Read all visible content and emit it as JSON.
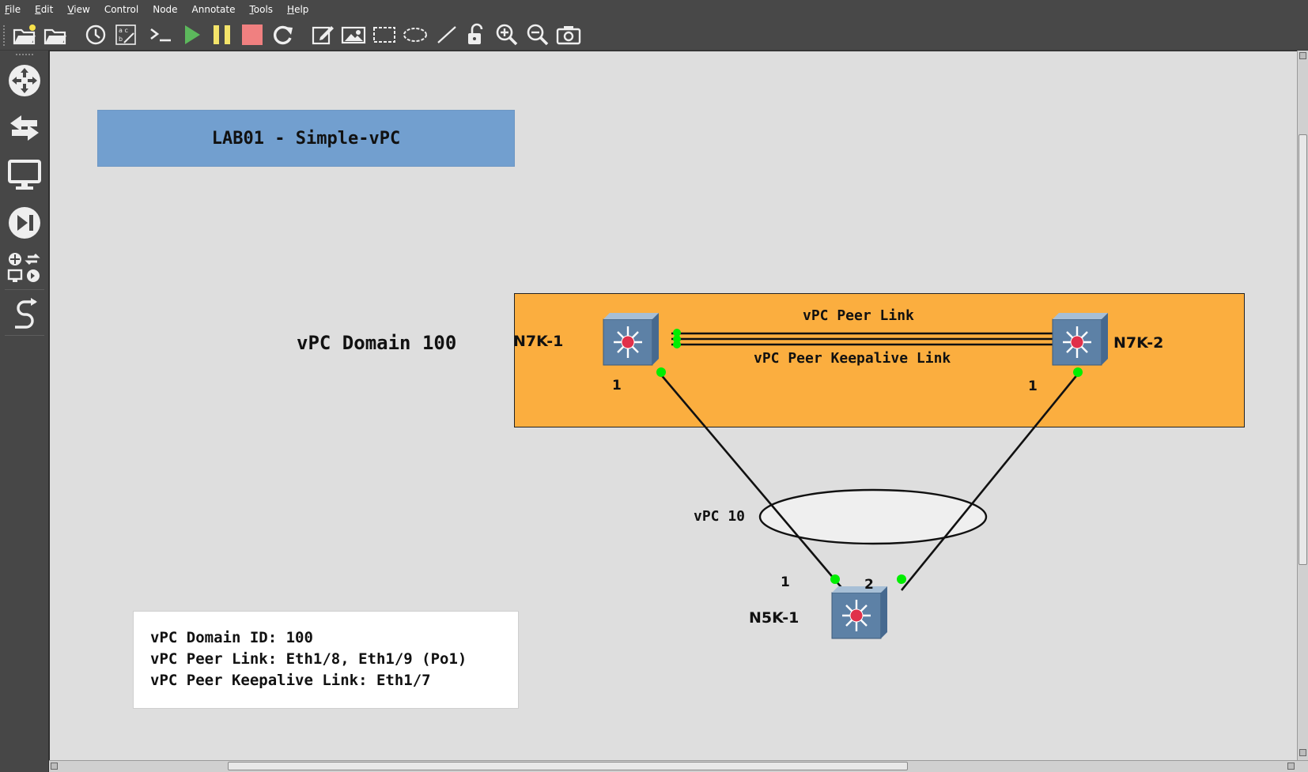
{
  "menu": [
    "File",
    "Edit",
    "View",
    "Control",
    "Node",
    "Annotate",
    "Tools",
    "Help"
  ],
  "toolbar": {
    "icons": [
      "new-project-icon",
      "open-project-icon",
      "snapshot-clock-icon",
      "show-interface-labels-icon",
      "console-icon",
      "start-icon",
      "pause-icon",
      "stop-icon",
      "reload-icon",
      "add-note-icon",
      "insert-image-icon",
      "draw-rectangle-icon",
      "draw-ellipse-icon",
      "draw-line-icon",
      "lock-icon",
      "zoom-in-icon",
      "zoom-out-icon",
      "screenshot-icon"
    ],
    "colors": {
      "start": "#5cb85c",
      "pause": "#f4e46a",
      "stop": "#f08080"
    }
  },
  "dock": {
    "icons": [
      "routers-icon",
      "switches-icon",
      "end-devices-icon",
      "security-devices-icon",
      "all-devices-icon",
      "add-link-icon"
    ]
  },
  "canvas": {
    "title": "LAB01 - Simple-vPC",
    "title_color": "#729fcf",
    "domain_label": "vPC Domain 100",
    "domain_color": "#fbae3f",
    "peer_link_label": "vPC Peer Link",
    "keepalive_label": "vPC Peer Keepalive Link",
    "vpc_label": "vPC 10",
    "nodes": {
      "n7k1": "N7K-1",
      "n7k2": "N7K-2",
      "n5k1": "N5K-1"
    },
    "ports": {
      "n7k1_down": "1",
      "n7k2_down": "1",
      "n5k1_left": "1",
      "n5k1_right": "2"
    },
    "port_status_color": "#00ee00",
    "notes": [
      "vPC Domain ID: 100",
      "vPC Peer Link: Eth1/8, Eth1/9 (Po1)",
      "vPC Peer Keepalive Link: Eth1/7"
    ]
  }
}
